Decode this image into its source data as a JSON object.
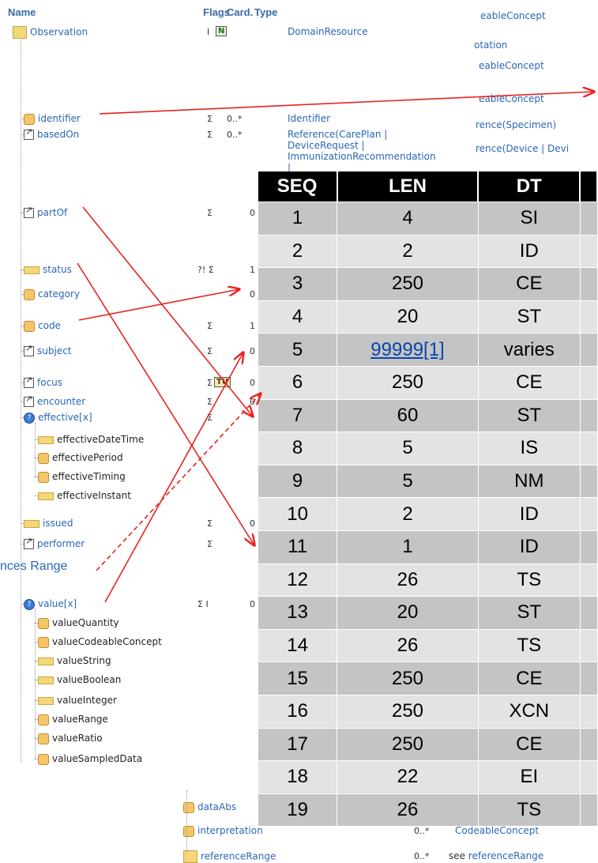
{
  "fhir": {
    "headers": {
      "name": "Name",
      "flags": "Flags",
      "card": "Card.",
      "type": "Type"
    },
    "rows": [
      {
        "key": "observation",
        "name": "Observation",
        "flags": "I",
        "badge": "N",
        "card": "",
        "type": "DomainResource",
        "icon": "resource-icon"
      },
      {
        "key": "identifier",
        "name": "identifier",
        "flags": "Σ",
        "card": "0..*",
        "type": "Identifier",
        "icon": "datatype-icon"
      },
      {
        "key": "basedOn",
        "name": "basedOn",
        "flags": "Σ",
        "card": "0..*",
        "type": "Reference(CarePlan | DeviceRequest | ImmunizationRecommendation |",
        "icon": "reference-icon"
      },
      {
        "key": "partOf",
        "name": "partOf",
        "flags": "Σ",
        "card": "0",
        "icon": "reference-icon"
      },
      {
        "key": "status",
        "name": "status",
        "flags": "?! Σ",
        "card": "1",
        "icon": "primitive-icon"
      },
      {
        "key": "category",
        "name": "category",
        "flags": "",
        "card": "0",
        "icon": "datatype-icon"
      },
      {
        "key": "code",
        "name": "code",
        "flags": "Σ",
        "card": "1",
        "icon": "datatype-icon"
      },
      {
        "key": "subject",
        "name": "subject",
        "flags": "Σ",
        "card": "0",
        "icon": "reference-icon"
      },
      {
        "key": "focus",
        "name": "focus",
        "flags": "Σ",
        "badge": "TU",
        "card": "0",
        "icon": "reference-icon"
      },
      {
        "key": "encounter",
        "name": "encounter",
        "flags": "Σ",
        "card": "0",
        "icon": "reference-icon"
      },
      {
        "key": "effective",
        "name": "effective[x]",
        "flags": "Σ",
        "card": "",
        "icon": "choice-icon"
      },
      {
        "key": "effectiveDateTime",
        "name": "effectiveDateTime",
        "sub": true,
        "icon": "primitive-icon"
      },
      {
        "key": "effectivePeriod",
        "name": "effectivePeriod",
        "sub": true,
        "icon": "datatype-icon"
      },
      {
        "key": "effectiveTiming",
        "name": "effectiveTiming",
        "sub": true,
        "icon": "datatype-icon"
      },
      {
        "key": "effectiveInstant",
        "name": "effectiveInstant",
        "sub": true,
        "icon": "primitive-icon"
      },
      {
        "key": "issued",
        "name": "issued",
        "flags": "Σ",
        "card": "0",
        "icon": "primitive-icon"
      },
      {
        "key": "performer",
        "name": "performer",
        "flags": "Σ",
        "card": "",
        "icon": "reference-icon"
      },
      {
        "key": "value",
        "name": "value[x]",
        "flags": "Σ I",
        "card": "0",
        "icon": "choice-icon"
      },
      {
        "key": "valueQuantity",
        "name": "valueQuantity",
        "sub": true,
        "icon": "datatype-icon"
      },
      {
        "key": "valueCodeableConcept",
        "name": "valueCodeableConcept",
        "sub": true,
        "icon": "datatype-icon"
      },
      {
        "key": "valueString",
        "name": "valueString",
        "sub": true,
        "icon": "primitive-icon"
      },
      {
        "key": "valueBoolean",
        "name": "valueBoolean",
        "sub": true,
        "icon": "primitive-icon"
      },
      {
        "key": "valueInteger",
        "name": "valueInteger",
        "sub": true,
        "icon": "primitive-icon"
      },
      {
        "key": "valueRange",
        "name": "valueRange",
        "sub": true,
        "icon": "datatype-icon"
      },
      {
        "key": "valueRatio",
        "name": "valueRatio",
        "sub": true,
        "icon": "datatype-icon"
      },
      {
        "key": "valueSampledData",
        "name": "valueSampledData",
        "sub": true,
        "icon": "datatype-icon"
      }
    ],
    "bottom_rows": [
      {
        "name": "dataAbs",
        "card": "",
        "type": ""
      },
      {
        "name": "interpretation",
        "card": "0..*",
        "type": "CodeableConcept"
      },
      {
        "name": "referenceRange",
        "card": "0..*",
        "type_prefix": "see ",
        "type": "referenceRange"
      }
    ],
    "right_fragments": [
      "eableConcept",
      "otation",
      "eableConcept",
      "eableConcept",
      "rence(Specimen)",
      "rence(Device | Devi"
    ]
  },
  "annotation": "nces Range",
  "hl7_table": {
    "headers": [
      "SEQ",
      "LEN",
      "DT",
      ""
    ],
    "rows": [
      {
        "seq": "1",
        "len": "4",
        "dt": "SI"
      },
      {
        "seq": "2",
        "len": "2",
        "dt": "ID"
      },
      {
        "seq": "3",
        "len": "250",
        "dt": "CE"
      },
      {
        "seq": "4",
        "len": "20",
        "dt": "ST"
      },
      {
        "seq": "5",
        "len": "99999[1]",
        "dt": "varies",
        "link": true
      },
      {
        "seq": "6",
        "len": "250",
        "dt": "CE"
      },
      {
        "seq": "7",
        "len": "60",
        "dt": "ST"
      },
      {
        "seq": "8",
        "len": "5",
        "dt": "IS"
      },
      {
        "seq": "9",
        "len": "5",
        "dt": "NM"
      },
      {
        "seq": "10",
        "len": "2",
        "dt": "ID"
      },
      {
        "seq": "11",
        "len": "1",
        "dt": "ID"
      },
      {
        "seq": "12",
        "len": "26",
        "dt": "TS"
      },
      {
        "seq": "13",
        "len": "20",
        "dt": "ST"
      },
      {
        "seq": "14",
        "len": "26",
        "dt": "TS"
      },
      {
        "seq": "15",
        "len": "250",
        "dt": "CE"
      },
      {
        "seq": "16",
        "len": "250",
        "dt": "XCN"
      },
      {
        "seq": "17",
        "len": "250",
        "dt": "CE"
      },
      {
        "seq": "18",
        "len": "22",
        "dt": "EI"
      },
      {
        "seq": "19",
        "len": "26",
        "dt": "TS"
      }
    ]
  },
  "colors": {
    "arrow": "#e8231f",
    "link": "#2a66b5",
    "header_bg": "#000000"
  }
}
